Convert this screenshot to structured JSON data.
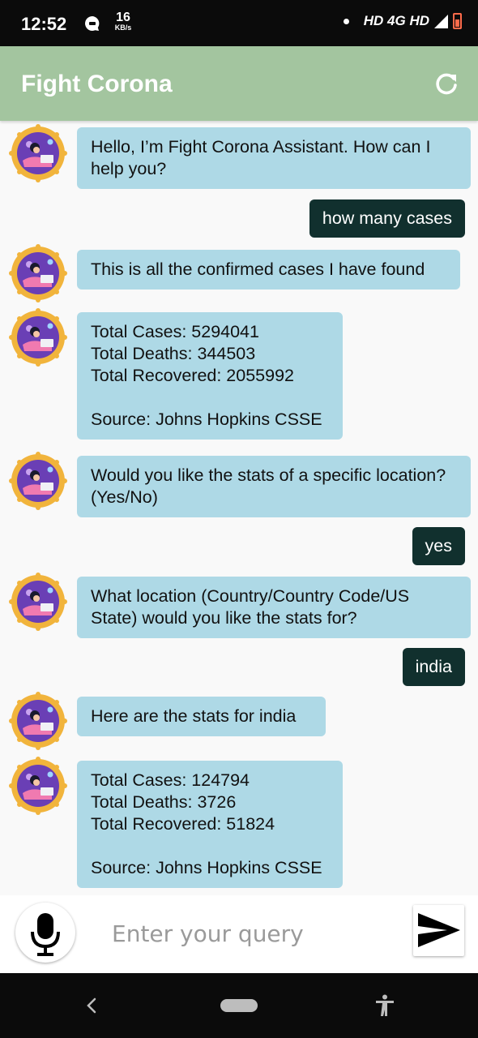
{
  "status_bar": {
    "time": "12:52",
    "speed_value": "16",
    "speed_unit": "KB/s",
    "network": "HD 4G HD",
    "icons": [
      "message-icon",
      "signal-icon",
      "battery-icon"
    ]
  },
  "app_bar": {
    "title": "Fight Corona",
    "refresh_icon": "refresh-icon",
    "color": "#a3c59f"
  },
  "messages": [
    {
      "sender": "bot",
      "text": "Hello, I’m Fight Corona Assistant. How can I help you?"
    },
    {
      "sender": "user",
      "text": "how many cases"
    },
    {
      "sender": "bot",
      "text": "This is all the confirmed cases I have found"
    },
    {
      "sender": "bot",
      "text": "Total Cases: 5294041\nTotal Deaths: 344503\nTotal Recovered: 2055992\n\nSource: Johns Hopkins CSSE"
    },
    {
      "sender": "bot",
      "text": "Would you like the stats of a specific location?(Yes/No)"
    },
    {
      "sender": "user",
      "text": "yes"
    },
    {
      "sender": "bot",
      "text": "What location (Country/Country Code/US State) would you like the stats for?"
    },
    {
      "sender": "user",
      "text": "india"
    },
    {
      "sender": "bot",
      "text": "Here are the stats for india"
    },
    {
      "sender": "bot",
      "text": "Total Cases: 124794\nTotal Deaths: 3726\nTotal Recovered: 51824\n\nSource: Johns Hopkins CSSE"
    }
  ],
  "input": {
    "placeholder": "Enter your query",
    "value": ""
  },
  "colors": {
    "bot_bubble": "#aed9e6",
    "user_bubble": "#11302e",
    "avatar_ring": "#f1b43c",
    "avatar_fill": "#6a3fb5"
  }
}
